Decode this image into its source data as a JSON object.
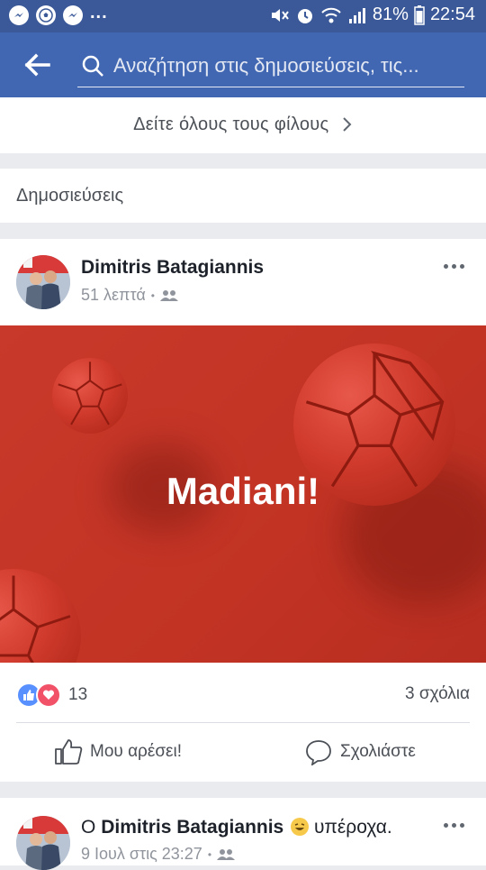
{
  "status_bar": {
    "battery": "81%",
    "time": "22:54"
  },
  "search": {
    "placeholder": "Αναζήτηση στις δημοσιεύσεις, τις..."
  },
  "see_all_friends": "Δείτε όλους τους φίλους",
  "posts_section": "Δημοσιεύσεις",
  "post1": {
    "author": "Dimitris Batagiannis",
    "time": "51 λεπτά",
    "image_text": "Madiani!",
    "reaction_count": "13",
    "comments": "3 σχόλια",
    "like_label": "Μου αρέσει!",
    "comment_label": "Σχολιάστε"
  },
  "post2": {
    "prefix": "Ο",
    "author": "Dimitris Batagiannis",
    "suffix": "υπέροχα.",
    "time": "9 Ιουλ στις 23:27"
  },
  "colors": {
    "header": "#4267b2",
    "status": "#3b5998",
    "image": "#c9392b"
  }
}
